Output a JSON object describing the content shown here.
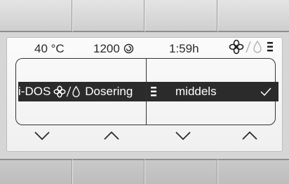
{
  "status": {
    "temperature": "40 °C",
    "spin_speed": "1200",
    "remaining_time": "1:59h",
    "icons": [
      "fan-icon",
      "drop-icon",
      "level-icon"
    ]
  },
  "menu": {
    "left_label_prefix": "i-DOS",
    "left_label_suffix": "Dosering",
    "right_value": "middels"
  },
  "colors": {
    "selection_bar": "#2b2b2b",
    "screen_bg": "#f6f6f6",
    "inactive_icon": "#b0b0b0"
  }
}
